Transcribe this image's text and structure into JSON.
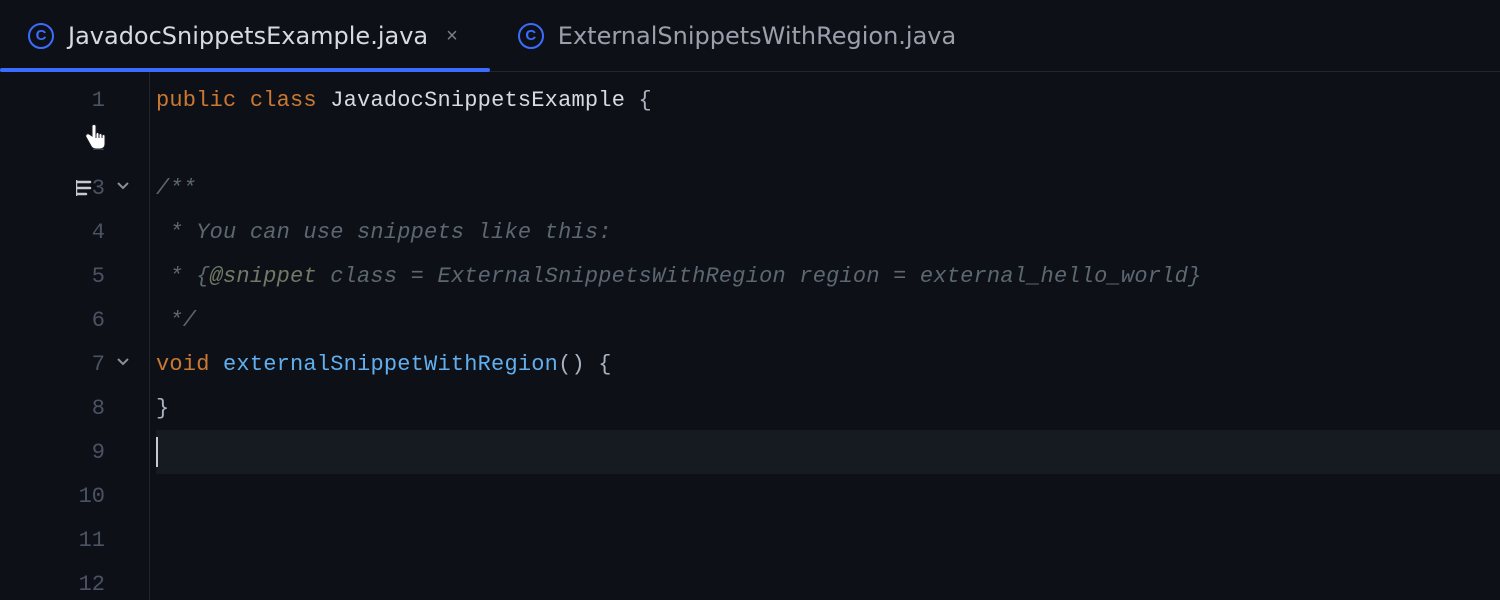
{
  "tabs": [
    {
      "icon_letter": "C",
      "label": "JavadocSnippetsExample.java",
      "active": true,
      "closeable": true
    },
    {
      "icon_letter": "C",
      "label": "ExternalSnippetsWithRegion.java",
      "active": false,
      "closeable": false
    }
  ],
  "gutter": {
    "lines": [
      {
        "num": "1",
        "fold": false,
        "doc_glyph": false
      },
      {
        "num": "2",
        "fold": false,
        "doc_glyph": false
      },
      {
        "num": "3",
        "fold": true,
        "doc_glyph": true
      },
      {
        "num": "4",
        "fold": false,
        "doc_glyph": false
      },
      {
        "num": "5",
        "fold": false,
        "doc_glyph": false
      },
      {
        "num": "6",
        "fold": false,
        "doc_glyph": false
      },
      {
        "num": "7",
        "fold": true,
        "doc_glyph": false
      },
      {
        "num": "8",
        "fold": false,
        "doc_glyph": false
      },
      {
        "num": "9",
        "fold": false,
        "doc_glyph": false
      },
      {
        "num": "10",
        "fold": false,
        "doc_glyph": false
      },
      {
        "num": "11",
        "fold": false,
        "doc_glyph": false
      },
      {
        "num": "12",
        "fold": false,
        "doc_glyph": false
      }
    ]
  },
  "code": {
    "l1": {
      "kw1": "public",
      "kw2": "class",
      "type": "JavadocSnippetsExample",
      "brace": "{"
    },
    "l3": {
      "text": "/**"
    },
    "l4": {
      "text": " * You can use snippets like this:"
    },
    "l5": {
      "prefix": " * {",
      "tag": "@snippet",
      "rest": " class = ExternalSnippetsWithRegion region = external_hello_world}"
    },
    "l6": {
      "text": " */"
    },
    "l7": {
      "kw": "void",
      "method": "externalSnippetWithRegion",
      "parens": "()",
      "brace": "{"
    },
    "l8": {
      "brace": "}"
    }
  },
  "current_line_index": 8
}
